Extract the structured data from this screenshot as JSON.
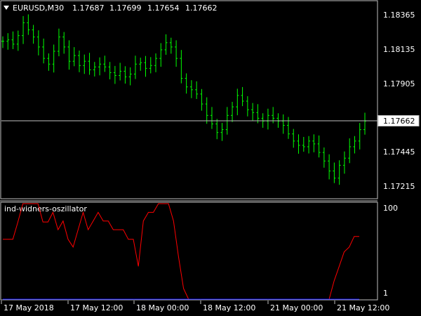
{
  "header": {
    "symbol_tf": "EURUSD,M30",
    "o": "1.17687",
    "h": "1.17699",
    "l": "1.17654",
    "c": "1.17662"
  },
  "price_axis": {
    "labels": [
      "1.18365",
      "1.18135",
      "1.17905",
      "1.17662",
      "1.17445",
      "1.17215"
    ],
    "current": "1.17662"
  },
  "indicator": {
    "title": "ind-widners-oszillator",
    "scale_labels": [
      "100",
      "1"
    ]
  },
  "time_axis": {
    "labels": [
      "17 May 2018",
      "17 May 12:00",
      "18 May 00:00",
      "18 May 12:00",
      "21 May 00:00",
      "21 May 12:00"
    ]
  },
  "colors": {
    "background": "#000000",
    "candle": "#00ff00",
    "osc_red": "#ff0000",
    "osc_blue": "#0000ff",
    "grid": "#c0c0c0",
    "text": "#ffffff"
  },
  "chart_data": [
    {
      "type": "line",
      "title": "EURUSD,M30",
      "series": [
        {
          "name": "EURUSD,M30",
          "values": [
            1.1822,
            1.1823,
            1.182,
            1.1826,
            1.1835,
            1.183,
            1.1825,
            1.1818,
            1.181,
            1.1806,
            1.1815,
            1.1825,
            1.1818,
            1.1808,
            1.1812,
            1.1805,
            1.1808,
            1.1802,
            1.1804,
            1.1806,
            1.1804,
            1.18,
            1.1798,
            1.1801,
            1.1797,
            1.1799,
            1.1806,
            1.1807,
            1.1803,
            1.1805,
            1.181,
            1.1816,
            1.1821,
            1.1818,
            1.181,
            1.1796,
            1.179,
            1.1788,
            1.1785,
            1.1778,
            1.177,
            1.1764,
            1.1758,
            1.176,
            1.177,
            1.1776,
            1.1784,
            1.178,
            1.1774,
            1.1772,
            1.1768,
            1.1766,
            1.177,
            1.1768,
            1.1766,
            1.1763,
            1.1757,
            1.1752,
            1.1749,
            1.1748,
            1.1752,
            1.175,
            1.1744,
            1.1738,
            1.1731,
            1.1726,
            1.1735,
            1.174,
            1.1748,
            1.1752,
            1.176,
            1.1766
          ]
        }
      ],
      "x_labels": [
        "17 May 2018",
        "17 May 12:00",
        "18 May 00:00",
        "18 May 12:00",
        "21 May 00:00",
        "21 May 12:00"
      ],
      "ylim": [
        1.1713,
        1.1849
      ],
      "current_price": 1.17662
    },
    {
      "type": "line",
      "title": "ind-widners-oszillator",
      "series": [
        {
          "values": [
            63,
            63,
            63,
            81,
            100,
            100,
            100,
            100,
            81,
            81,
            91,
            73,
            82,
            63,
            55,
            73,
            91,
            73,
            82,
            91,
            82,
            82,
            73,
            73,
            73,
            63,
            63,
            35,
            82,
            91,
            91,
            100,
            100,
            100,
            82,
            45,
            12,
            1,
            1,
            1,
            1,
            1,
            1,
            1,
            1,
            1,
            1,
            1,
            1,
            1,
            1,
            1,
            1,
            1,
            1,
            1,
            1,
            1,
            1,
            1,
            1,
            1,
            1,
            1,
            1,
            1,
            20,
            35,
            50,
            55,
            66,
            66
          ]
        },
        {
          "values": [
            1,
            1,
            1,
            1,
            1,
            1,
            1,
            1,
            1,
            1,
            1,
            1,
            1,
            1,
            1,
            1,
            1,
            1,
            1,
            1,
            1,
            1,
            1,
            1,
            1,
            1,
            1,
            1,
            1,
            1,
            1,
            1,
            1,
            1,
            1,
            1,
            1,
            1,
            1,
            1,
            1,
            1,
            1,
            1,
            1,
            1,
            1,
            1,
            1,
            1,
            1,
            1,
            1,
            1,
            1,
            1,
            1,
            1,
            1,
            1,
            1,
            1,
            1,
            1,
            1,
            1,
            1,
            1,
            1,
            1,
            1,
            1
          ]
        }
      ],
      "ylim": [
        1,
        100
      ],
      "y_labels": [
        "100",
        "1"
      ]
    }
  ]
}
